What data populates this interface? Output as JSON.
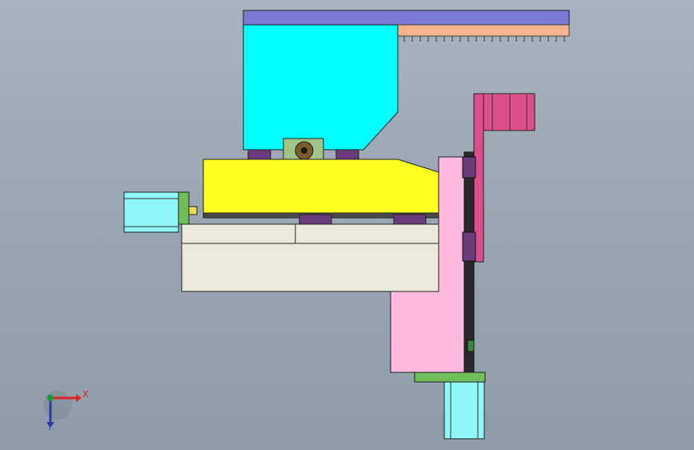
{
  "viewport": {
    "background_top": "#a9b3bf",
    "background_bottom": "#8f9caa"
  },
  "axis_triad": {
    "x_label": "X",
    "y_label": "Y",
    "x_color": "#e0262b",
    "y_color": "#2b3ca8",
    "z_color": "#1a9e2a"
  },
  "colors": {
    "hopper": "#00ffff",
    "top_rail": "#7a79d4",
    "comb_strip": "#f5b48a",
    "conveyor_body": "#ffff1f",
    "base_block": "#e9e9dc",
    "vertical_plate": "#ffb9dc",
    "magenta_bracket": "#dd4f8a",
    "motor_cyan": "#8ff7f7",
    "mount_green": "#6fbe5a",
    "slider_purple": "#6a3b7a"
  },
  "icons": {
    "triad": "axis-triad-icon"
  }
}
